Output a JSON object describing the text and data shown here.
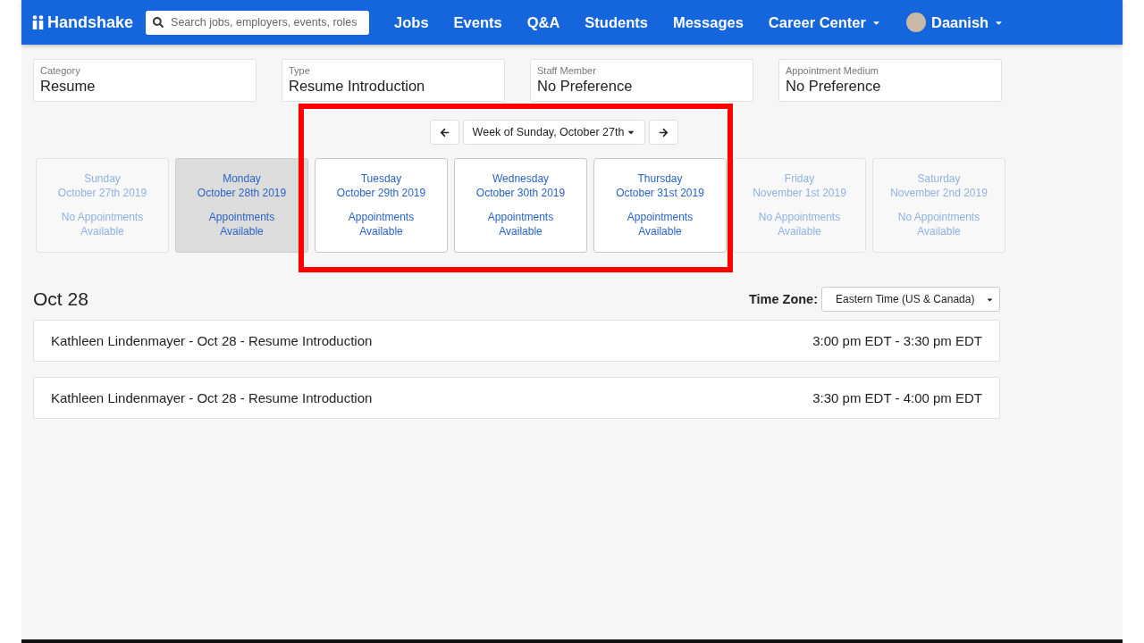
{
  "navbar": {
    "logo": "Handshake",
    "search": {
      "placeholder": "Search jobs, employers, events, roles"
    },
    "links": [
      {
        "label": "Jobs",
        "dropdown": false
      },
      {
        "label": "Events",
        "dropdown": false
      },
      {
        "label": "Q&A",
        "dropdown": false
      },
      {
        "label": "Students",
        "dropdown": false
      },
      {
        "label": "Messages",
        "dropdown": false
      },
      {
        "label": "Career Center",
        "dropdown": true
      }
    ],
    "user": {
      "name": "Daanish"
    }
  },
  "filters": [
    {
      "label": "Category",
      "value": "Resume"
    },
    {
      "label": "Type",
      "value": "Resume Introduction"
    },
    {
      "label": "Staff Member",
      "value": "No Preference"
    },
    {
      "label": "Appointment Medium",
      "value": "No Preference"
    }
  ],
  "week_picker": {
    "label": "Week of Sunday, October 27th"
  },
  "days": [
    {
      "day": "Sunday",
      "date": "October 27th 2019",
      "status": "No Appointments Available",
      "available": false,
      "selected": false
    },
    {
      "day": "Monday",
      "date": "October 28th 2019",
      "status": "Appointments Available",
      "available": true,
      "selected": true
    },
    {
      "day": "Tuesday",
      "date": "October 29th 2019",
      "status": "Appointments Available",
      "available": true,
      "selected": false
    },
    {
      "day": "Wednesday",
      "date": "October 30th 2019",
      "status": "Appointments Available",
      "available": true,
      "selected": false
    },
    {
      "day": "Thursday",
      "date": "October 31st 2019",
      "status": "Appointments Available",
      "available": true,
      "selected": false
    },
    {
      "day": "Friday",
      "date": "November 1st 2019",
      "status": "No Appointments Available",
      "available": false,
      "selected": false
    },
    {
      "day": "Saturday",
      "date": "November 2nd 2019",
      "status": "No Appointments Available",
      "available": false,
      "selected": false
    }
  ],
  "schedule": {
    "heading": "Oct 28",
    "time_zone": {
      "label": "Time Zone:",
      "value": "Eastern Time (US & Canada)"
    },
    "slots": [
      {
        "title": "Kathleen Lindenmayer - Oct 28 - Resume Introduction",
        "time": "3:00 pm EDT - 3:30 pm EDT"
      },
      {
        "title": "Kathleen Lindenmayer - Oct 28 - Resume Introduction",
        "time": "3:30 pm EDT - 4:00 pm EDT"
      }
    ]
  }
}
